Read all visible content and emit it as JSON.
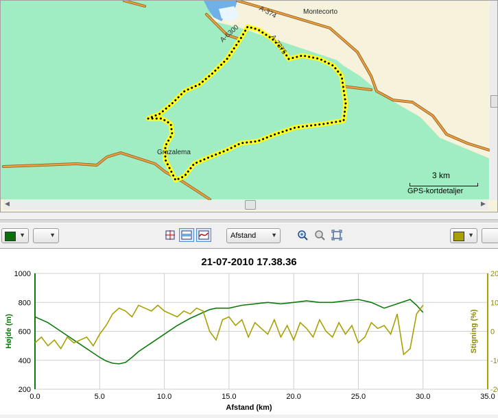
{
  "map": {
    "places": {
      "montecorto": "Montecorto",
      "grazalema": "Grazalema"
    },
    "roads": {
      "a374": "A-374",
      "a6300": "A-6300",
      "a7375": "A-7375"
    },
    "scale": "3 km",
    "credit": "GPS-kortdetaljer"
  },
  "toolbar": {
    "left_color": "#0a6e0a",
    "right_color": "#a8a000",
    "axis_select": "Afstand",
    "icons": [
      "crosshair-icon",
      "fill-icon",
      "curve-icon",
      "zoom-in-icon",
      "zoom-out-icon",
      "zoom-fit-icon"
    ]
  },
  "chart_data": {
    "type": "line",
    "title": "21-07-2010 17.38.36",
    "xlabel": "Afstand (km)",
    "ylabel_left": "Højde (m)",
    "ylabel_right": "Stigning (%)",
    "xlim": [
      0,
      35
    ],
    "ylim_left": [
      200,
      1000
    ],
    "ylim_right": [
      -20,
      20
    ],
    "x_ticks": [
      "0.0",
      "5.0",
      "10.0",
      "15.0",
      "20.0",
      "25.0",
      "30.0",
      "35.0"
    ],
    "y_ticks_left": [
      "200",
      "400",
      "600",
      "800",
      "1000"
    ],
    "y_ticks_right": [
      "-20",
      "-10",
      "0",
      "10",
      "20"
    ],
    "grid": true,
    "series": [
      {
        "name": "",
        "axis": "left",
        "color": "#0a7a0a",
        "x": [
          0,
          1,
          2,
          3,
          4,
          5,
          5.5,
          6,
          6.5,
          7,
          7.5,
          8,
          9,
          10,
          11,
          12,
          13,
          13.5,
          14,
          15,
          16,
          17,
          18,
          19,
          20,
          21,
          22,
          23,
          24,
          25,
          26,
          27,
          28,
          29,
          29.5,
          30
        ],
        "values": [
          700,
          660,
          600,
          540,
          480,
          420,
          395,
          380,
          375,
          385,
          420,
          460,
          520,
          580,
          640,
          690,
          730,
          750,
          760,
          760,
          780,
          790,
          800,
          790,
          800,
          810,
          800,
          800,
          810,
          820,
          800,
          760,
          790,
          820,
          780,
          730
        ]
      },
      {
        "name": "",
        "axis": "right",
        "color": "#a8a000",
        "x": [
          0,
          0.5,
          1,
          1.5,
          2,
          2.5,
          3,
          3.5,
          4,
          4.5,
          5,
          5.5,
          6,
          6.5,
          7,
          7.5,
          8,
          8.5,
          9,
          9.5,
          10,
          10.5,
          11,
          11.5,
          12,
          12.5,
          13,
          13.5,
          14,
          14.5,
          15,
          15.5,
          16,
          16.5,
          17,
          17.5,
          18,
          18.5,
          19,
          19.5,
          20,
          20.5,
          21,
          21.5,
          22,
          22.5,
          23,
          23.5,
          24,
          24.5,
          25,
          25.5,
          26,
          26.5,
          27,
          27.5,
          28,
          28.5,
          29,
          29.5,
          30
        ],
        "values": [
          -4,
          -2,
          -5,
          -3,
          -6,
          -2,
          -4,
          -3,
          -2,
          -5,
          -1,
          2,
          6,
          8,
          7,
          5,
          9,
          8,
          7,
          9,
          7,
          6,
          5,
          7,
          6,
          8,
          7,
          0,
          -3,
          4,
          5,
          2,
          4,
          -2,
          3,
          1,
          -1,
          4,
          -2,
          2,
          -3,
          3,
          1,
          -2,
          4,
          0,
          -2,
          3,
          -1,
          2,
          -4,
          -2,
          3,
          1,
          2,
          -1,
          6,
          -8,
          -6,
          6,
          9
        ]
      }
    ]
  }
}
